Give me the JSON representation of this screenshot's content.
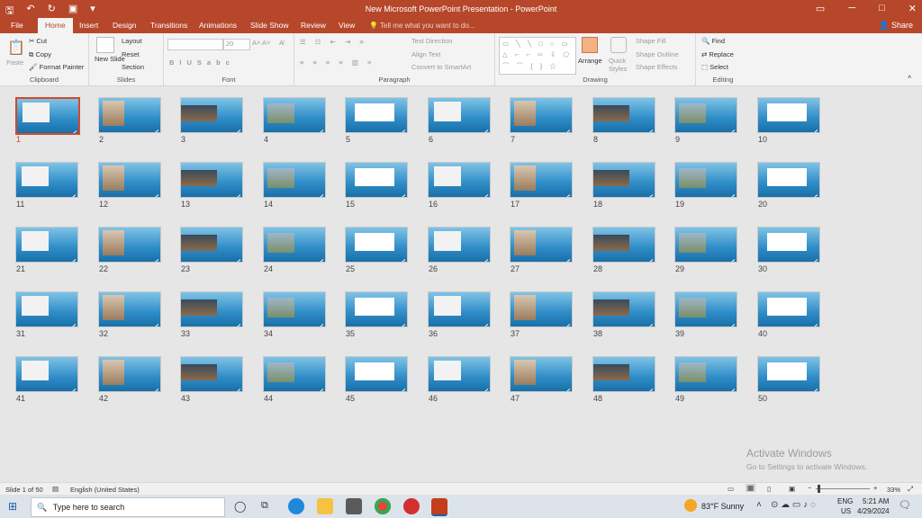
{
  "titlebar": {
    "title": "New Microsoft PowerPoint Presentation - PowerPoint",
    "qat": [
      "save-icon",
      "undo-icon",
      "redo-icon",
      "present-icon",
      "customize-icon"
    ]
  },
  "tabs": [
    "File",
    "Home",
    "Insert",
    "Design",
    "Transitions",
    "Animations",
    "Slide Show",
    "Review",
    "View"
  ],
  "active_tab": "Home",
  "tell_me": "Tell me what you want to do...",
  "share": "Share",
  "ribbon": {
    "clipboard": {
      "label": "Clipboard",
      "paste": "Paste",
      "cut": "Cut",
      "copy": "Copy",
      "format_painter": "Format Painter"
    },
    "slides": {
      "label": "Slides",
      "new_slide": "New Slide",
      "layout": "Layout",
      "reset": "Reset",
      "section": "Section"
    },
    "font": {
      "label": "Font",
      "size": "20"
    },
    "paragraph": {
      "label": "Paragraph",
      "text_direction": "Text Direction",
      "align_text": "Align Text",
      "smartart": "Convert to SmartArt"
    },
    "drawing": {
      "label": "Drawing",
      "arrange": "Arrange",
      "quick_styles": "Quick Styles",
      "shape_fill": "Shape Fill",
      "shape_outline": "Shape Outline",
      "shape_effects": "Shape Effects"
    },
    "editing": {
      "label": "Editing",
      "find": "Find",
      "replace": "Replace",
      "select": "Select"
    }
  },
  "slides": {
    "count": 50,
    "selected": 1,
    "numbers": [
      "1",
      "2",
      "3",
      "4",
      "5",
      "6",
      "7",
      "8",
      "9",
      "10",
      "11",
      "12",
      "13",
      "14",
      "15",
      "16",
      "17",
      "18",
      "19",
      "20",
      "21",
      "22",
      "23",
      "24",
      "25",
      "26",
      "27",
      "28",
      "29",
      "30",
      "31",
      "32",
      "33",
      "34",
      "35",
      "36",
      "37",
      "38",
      "39",
      "40",
      "41",
      "42",
      "43",
      "44",
      "45",
      "46",
      "47",
      "48",
      "49",
      "50"
    ]
  },
  "watermark": {
    "line1": "Activate Windows",
    "line2": "Go to Settings to activate Windows."
  },
  "status": {
    "slide": "Slide 1 of 50",
    "language": "English (United States)",
    "zoom": "33%"
  },
  "taskbar": {
    "search_placeholder": "Type here to search",
    "weather": "83°F  Sunny",
    "lang": "ENG",
    "region": "US",
    "time": "5:21 AM",
    "date": "4/29/2024"
  },
  "colors": {
    "accent": "#b7472a",
    "slide_blue": "#2e8cc7",
    "selection": "#d2492a"
  }
}
